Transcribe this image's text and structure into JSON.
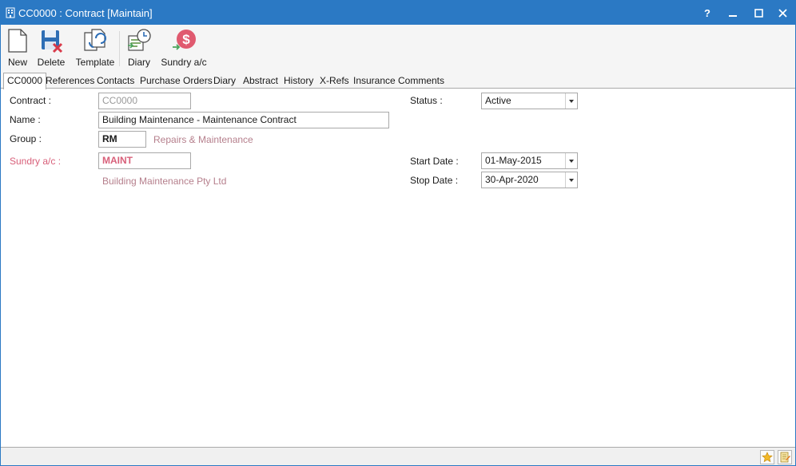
{
  "window": {
    "title": "CC0000 : Contract [Maintain]",
    "help_label": "?",
    "controls": [
      "minimize",
      "maximize",
      "close"
    ]
  },
  "toolbar": {
    "buttons": [
      {
        "label": "New",
        "icon": "new-document-icon"
      },
      {
        "label": "Delete",
        "icon": "delete-save-icon"
      },
      {
        "label": "Template",
        "icon": "template-icon"
      },
      {
        "label": "Diary",
        "icon": "diary-icon"
      },
      {
        "label": "Sundry a/c",
        "icon": "sundry-dollar-icon"
      }
    ]
  },
  "tabs": [
    "CC0000",
    "References",
    "Contacts",
    "Purchase Orders",
    "Diary",
    "Abstract",
    "History",
    "X-Refs",
    "Insurance",
    "Comments"
  ],
  "active_tab": "CC0000",
  "form": {
    "contract": {
      "label": "Contract :",
      "value": "CC0000"
    },
    "name": {
      "label": "Name :",
      "value": "Building Maintenance - Maintenance Contract"
    },
    "group": {
      "label": "Group :",
      "value": "RM",
      "description": "Repairs & Maintenance"
    },
    "sundry": {
      "label": "Sundry a/c :",
      "value": "MAINT",
      "description": "Building Maintenance Pty Ltd"
    },
    "status": {
      "label": "Status :",
      "value": "Active"
    },
    "start_date": {
      "label": "Start Date :",
      "value": "01-May-2015"
    },
    "stop_date": {
      "label": "Stop Date :",
      "value": "30-Apr-2020"
    }
  },
  "statusbar": {
    "buttons": [
      "favorite-star-icon",
      "notes-icon"
    ]
  },
  "colors": {
    "titlebar": "#2b79c4",
    "required_label": "#d8607a",
    "description_text": "#b57f8c"
  }
}
